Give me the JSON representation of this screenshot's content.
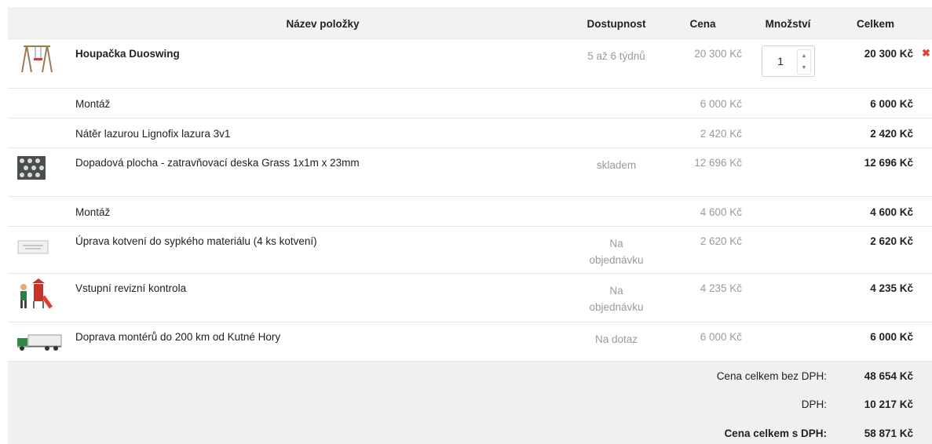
{
  "header": {
    "name": "Název položky",
    "availability": "Dostupnost",
    "price": "Cena",
    "quantity": "Množství",
    "total": "Celkem"
  },
  "items": [
    {
      "image": "swing-icon",
      "name": "Houpačka Duoswing",
      "availability": "5 až 6 týdnů",
      "price": "20 300 Kč",
      "quantity": "1",
      "total": "20 300 Kč"
    },
    {
      "name": "Montáž",
      "price": "6 000 Kč",
      "total": "6 000 Kč"
    },
    {
      "name": "Nátěr lazurou Lignofix lazura 3v1",
      "price": "2 420 Kč",
      "total": "2 420 Kč"
    },
    {
      "image": "grass-tile-icon",
      "name": "Dopadová plocha - zatravňovací deska Grass 1x1m x 23mm",
      "availability": "skladem",
      "price": "12 696 Kč",
      "total": "12 696 Kč"
    },
    {
      "name": "Montáž",
      "price": "4 600 Kč",
      "total": "4 600 Kč"
    },
    {
      "image": "anchoring-icon",
      "name": "Úprava kotvení do sypkého materiálu (4 ks kotvení)",
      "availability_line1": "Na",
      "availability_line2": "objednávku",
      "price": "2 620 Kč",
      "total": "2 620 Kč"
    },
    {
      "image": "playground-inspection-icon",
      "name": "Vstupní revizní kontrola",
      "availability_line1": "Na",
      "availability_line2": "objednávku",
      "price": "4 235 Kč",
      "total": "4 235 Kč"
    },
    {
      "image": "truck-icon",
      "name": "Doprava montérů do 200 km od Kutné Hory",
      "availability": "Na dotaz",
      "price": "6 000 Kč",
      "total": "6 000 Kč"
    }
  ],
  "summary": {
    "without_vat_label": "Cena celkem bez DPH:",
    "without_vat_value": "48 654 Kč",
    "vat_label": "DPH:",
    "vat_value": "10 217 Kč",
    "with_vat_label": "Cena celkem s DPH:",
    "with_vat_value": "58 871 Kč"
  },
  "colors": {
    "header_background": "#f2f2f2",
    "summary_background": "#f0f0f0",
    "remove_icon": "#d9452b",
    "muted_text": "#9a9a9a"
  }
}
